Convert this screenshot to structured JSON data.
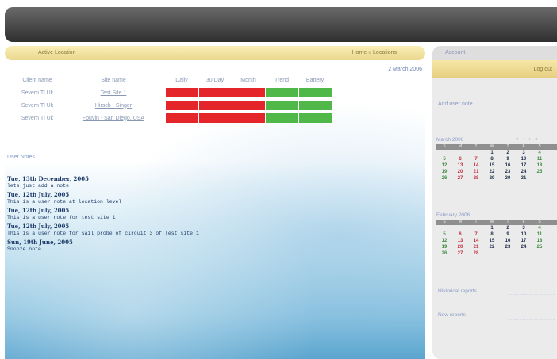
{
  "main": {
    "section_title": "Active Location",
    "section_link": "Home » Locations",
    "date": "2 March 2006",
    "columns": [
      "Client name",
      "Site name",
      "Daily",
      "30 Day",
      "Month",
      "Trend",
      "Battery"
    ],
    "rows": [
      {
        "client": "Severn Tl Uk",
        "site": "Test Site 1",
        "statuses": [
          "red",
          "red",
          "red",
          "green",
          "green"
        ]
      },
      {
        "client": "Severn Tl Uk",
        "site": "Hirsch - Singer",
        "statuses": [
          "red",
          "red",
          "red",
          "green",
          "green"
        ]
      },
      {
        "client": "Severn Tl Uk",
        "site": "Fouvin - San Diego, USA",
        "statuses": [
          "red",
          "red",
          "red",
          "green",
          "green"
        ]
      }
    ],
    "status_colors": {
      "red": "#e4262b",
      "green": "#4fb849"
    }
  },
  "notes": {
    "label": "User Notes",
    "items": [
      {
        "date": "Tue, 13th December, 2005",
        "text": "lets just add a note"
      },
      {
        "date": "Tue, 12th July, 2005",
        "text": "This is a user note at location level"
      },
      {
        "date": "Tue, 12th July, 2005",
        "text": "This is a user note for test site 1"
      },
      {
        "date": "Tue, 12th July, 2005",
        "text": "This is a user note for sail probe of circuit 3 of Test site 1"
      },
      {
        "date": "Sun, 19th June, 2005",
        "text": "Snooze note"
      }
    ]
  },
  "sidebar": {
    "title": "Account",
    "gold_link": "Log out",
    "add_note": "Add user note",
    "calendars": [
      {
        "title": "March 2006",
        "nav": "« ‹ › »",
        "dow": [
          "S",
          "M",
          "T",
          "W",
          "T",
          "F",
          "S"
        ],
        "weeks": [
          [
            "",
            "",
            "",
            "1",
            "2",
            "3",
            "4"
          ],
          [
            "5",
            "6",
            "7",
            "8",
            "9",
            "10",
            "11"
          ],
          [
            "12",
            "13",
            "14",
            "15",
            "16",
            "17",
            "18"
          ],
          [
            "19",
            "20",
            "21",
            "22",
            "23",
            "24",
            "25"
          ],
          [
            "26",
            "27",
            "28",
            "29",
            "30",
            "31",
            ""
          ]
        ]
      },
      {
        "title": "February 2006",
        "nav": "",
        "dow": [
          "S",
          "M",
          "T",
          "W",
          "T",
          "F",
          "S"
        ],
        "weeks": [
          [
            "",
            "",
            "",
            "1",
            "2",
            "3",
            "4"
          ],
          [
            "5",
            "6",
            "7",
            "8",
            "9",
            "10",
            "11"
          ],
          [
            "12",
            "13",
            "14",
            "15",
            "16",
            "17",
            "18"
          ],
          [
            "19",
            "20",
            "21",
            "22",
            "23",
            "24",
            "25"
          ],
          [
            "26",
            "27",
            "28",
            "",
            "",
            "",
            ""
          ]
        ]
      }
    ],
    "historical": "Historical reports",
    "new_reports": "New reports"
  }
}
